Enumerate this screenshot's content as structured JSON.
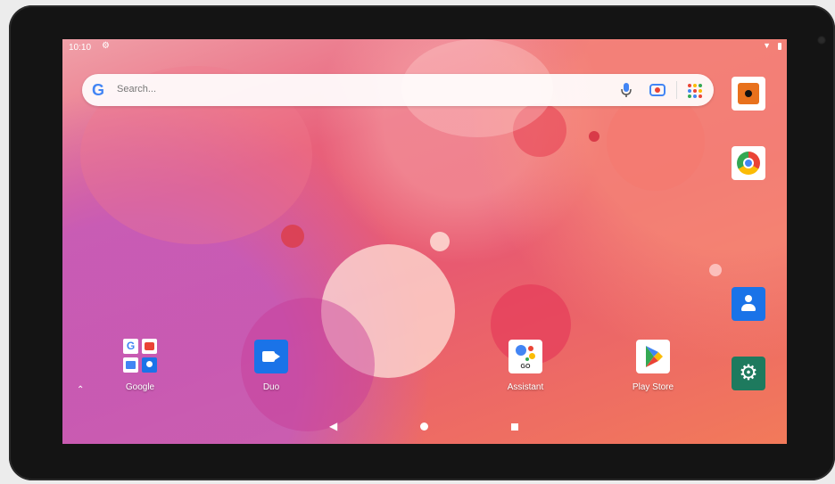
{
  "status_bar": {
    "time": "10:10",
    "icons": [
      "settings-icon",
      "wifi-icon",
      "battery-icon"
    ]
  },
  "search": {
    "placeholder": "Search...",
    "icons": [
      "google-g-icon",
      "mic-icon",
      "lens-icon",
      "apps-grid-icon"
    ]
  },
  "dock_apps": [
    {
      "label": "Google",
      "icon": "google-folder-icon"
    },
    {
      "label": "Duo",
      "icon": "duo-icon"
    },
    {
      "label": "Assistant",
      "icon": "assistant-icon"
    },
    {
      "label": "Play Store",
      "icon": "play-store-icon"
    }
  ],
  "right_column": [
    "camera-app-icon",
    "chrome-icon",
    "contacts-icon",
    "settings-app-icon"
  ],
  "nav_bar": [
    "back-button",
    "home-button",
    "recents-button"
  ],
  "colors": {
    "bezel": "#141414",
    "duo": "#1a73e8",
    "contacts": "#1a73e8",
    "settings_app": "#1e7a5e",
    "camera_app": "#e8711c"
  }
}
